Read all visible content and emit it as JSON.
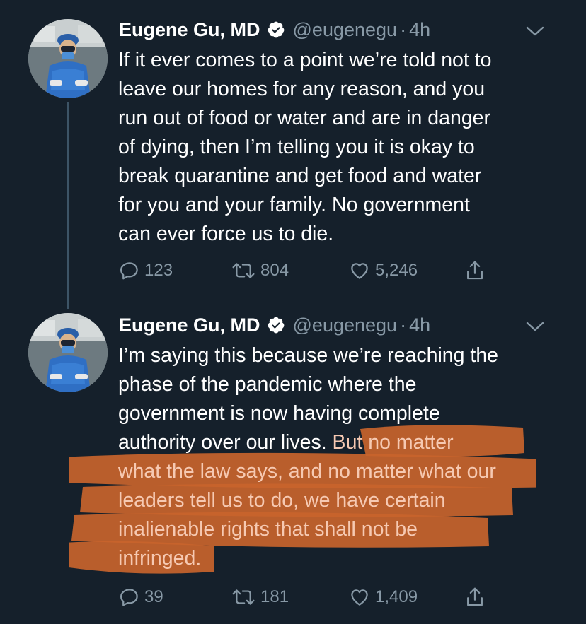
{
  "colors": {
    "background": "#15202b",
    "text": "#ffffff",
    "secondary": "#8899a6",
    "verified": "#ffffff",
    "highlight": "#c8642c",
    "highlight_text": "#f6c9b2",
    "thread_line": "#3d5466"
  },
  "tweets": [
    {
      "name": "Eugene Gu, MD",
      "handle": "@eugenegu",
      "dot": "·",
      "time": "4h",
      "verified_icon": "verified-badge-icon",
      "lines": [
        "If it ever comes to a point we’re told not to",
        "leave our homes for any reason, and you",
        "run out of food or water and are in danger",
        "of dying, then I’m telling you it is okay to",
        "break quarantine and get food and water",
        "for you and your family. No government",
        "can ever force us to die."
      ],
      "replies": "123",
      "retweets": "804",
      "likes": "5,246"
    },
    {
      "name": "Eugene Gu, MD",
      "handle": "@eugenegu",
      "dot": "·",
      "time": "4h",
      "verified_icon": "verified-badge-icon",
      "lines": [
        "I’m saying this because we’re reaching the",
        "phase of the pandemic where the",
        "government is now having complete"
      ],
      "line4_plain": "authority over our lives.",
      "line4_highlight": " But no matter",
      "highlighted_lines": [
        "what the law says, and no matter what our",
        "leaders tell us to do, we have certain",
        "inalienable rights that shall not be",
        "infringed."
      ],
      "replies": "39",
      "retweets": "181",
      "likes": "1,409"
    }
  ]
}
